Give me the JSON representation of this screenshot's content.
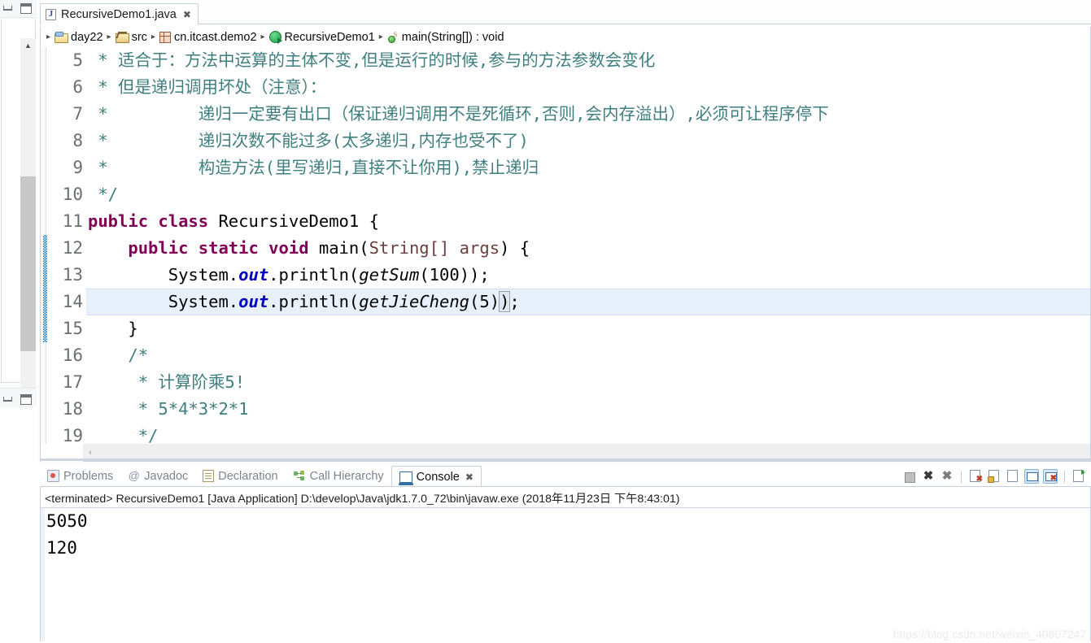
{
  "window": {
    "left_bar": {
      "minimize_icon": "minimize-icon",
      "maximize_icon": "maximize-icon",
      "scroll_up": "▲",
      "scroll_down": "▼"
    }
  },
  "editor": {
    "tab": {
      "label": "RecursiveDemo1.java",
      "close_glyph": "✖",
      "icon": "java-file-icon"
    },
    "breadcrumb": {
      "arrow": "▸",
      "items": [
        {
          "label": "day22",
          "icon": "project-folder-icon"
        },
        {
          "label": "src",
          "icon": "source-folder-icon"
        },
        {
          "label": "cn.itcast.demo2",
          "icon": "package-icon"
        },
        {
          "label": "RecursiveDemo1",
          "icon": "class-icon"
        },
        {
          "label": "main(String[]) : void",
          "icon": "method-static-icon"
        }
      ]
    },
    "first_visible_line": 5,
    "highlighted_line": 14,
    "changed_lines": {
      "from": 12,
      "to": 15
    },
    "lines": [
      {
        "num": "5",
        "segments": [
          {
            "t": " * ",
            "c": "cmt"
          },
          {
            "t": "适合于：方法中运算的主体不变,但是运行的时候,参与的方法参数会变化",
            "c": "cmt"
          }
        ]
      },
      {
        "num": "6",
        "segments": [
          {
            "t": " * ",
            "c": "cmt"
          },
          {
            "t": "但是递归调用坏处（注意）：",
            "c": "cmt"
          }
        ]
      },
      {
        "num": "7",
        "segments": [
          {
            "t": " * ",
            "c": "cmt"
          },
          {
            "t": "        递归一定要有出口（保证递归调用不是死循环,否则,会内存溢出）,必须可让程序停下",
            "c": "cmt"
          }
        ]
      },
      {
        "num": "8",
        "segments": [
          {
            "t": " * ",
            "c": "cmt"
          },
          {
            "t": "        递归次数不能过多(太多递归,内存也受不了)",
            "c": "cmt"
          }
        ]
      },
      {
        "num": "9",
        "segments": [
          {
            "t": " * ",
            "c": "cmt"
          },
          {
            "t": "        构造方法(里写递归,直接不让你用),禁止递归",
            "c": "cmt"
          }
        ]
      },
      {
        "num": "10",
        "segments": [
          {
            "t": " */",
            "c": "cmt"
          }
        ]
      },
      {
        "num": "11",
        "segments": [
          {
            "t": "public class ",
            "c": "kw"
          },
          {
            "t": "RecursiveDemo1 {",
            "c": "plain"
          }
        ]
      },
      {
        "num": "12",
        "segments": [
          {
            "t": "    ",
            "c": "plain"
          },
          {
            "t": "public static void ",
            "c": "kw"
          },
          {
            "t": "main(",
            "c": "plain"
          },
          {
            "t": "String[] args",
            "c": "param"
          },
          {
            "t": ") {",
            "c": "plain"
          }
        ]
      },
      {
        "num": "13",
        "segments": [
          {
            "t": "        System.",
            "c": "plain"
          },
          {
            "t": "out",
            "c": "stat"
          },
          {
            "t": ".println(",
            "c": "plain"
          },
          {
            "t": "getSum",
            "c": "mth"
          },
          {
            "t": "(100));",
            "c": "plain"
          }
        ]
      },
      {
        "num": "14",
        "segments": [
          {
            "t": "        System.",
            "c": "plain"
          },
          {
            "t": "out",
            "c": "stat"
          },
          {
            "t": ".println(",
            "c": "plain"
          },
          {
            "t": "getJieCheng",
            "c": "mth"
          },
          {
            "t": "(5)",
            "c": "plain"
          },
          {
            "t": ")",
            "c": "bracket"
          },
          {
            "t": ";",
            "c": "plain"
          }
        ]
      },
      {
        "num": "15",
        "segments": [
          {
            "t": "    }",
            "c": "plain"
          }
        ]
      },
      {
        "num": "16",
        "segments": [
          {
            "t": "    /*",
            "c": "cmt"
          }
        ]
      },
      {
        "num": "17",
        "segments": [
          {
            "t": "     * 计算阶乘5!",
            "c": "cmt"
          }
        ]
      },
      {
        "num": "18",
        "segments": [
          {
            "t": "     * 5*4*3*2*1",
            "c": "cmt"
          }
        ]
      },
      {
        "num": "19",
        "segments": [
          {
            "t": "     */",
            "c": "cmt"
          }
        ]
      }
    ],
    "hscroll_left_glyph": "‹"
  },
  "bottom_panel": {
    "tabs": [
      {
        "label": "Problems",
        "icon": "problems-icon",
        "active": false,
        "closable": false
      },
      {
        "label": "Javadoc",
        "icon": "javadoc-icon",
        "active": false,
        "closable": false
      },
      {
        "label": "Declaration",
        "icon": "declaration-icon",
        "active": false,
        "closable": false
      },
      {
        "label": "Call Hierarchy",
        "icon": "call-hierarchy-icon",
        "active": false,
        "closable": false
      },
      {
        "label": "Console",
        "icon": "console-icon",
        "active": true,
        "closable": true
      }
    ],
    "tab_close_glyph": "✖",
    "toolbar": [
      {
        "name": "terminate-button",
        "glyph": ""
      },
      {
        "name": "remove-launch-button",
        "glyph": "✖"
      },
      {
        "name": "remove-all-terminated-button",
        "glyph": "✖"
      },
      {
        "name": "clear-console-button",
        "glyph": ""
      },
      {
        "name": "scroll-lock-button",
        "glyph": ""
      },
      {
        "name": "word-wrap-button",
        "glyph": ""
      },
      {
        "name": "show-console-on-output-button",
        "glyph": ""
      },
      {
        "name": "pin-console-button",
        "glyph": ""
      },
      {
        "name": "display-selected-console-button",
        "glyph": ""
      }
    ],
    "console": {
      "status_line": "<terminated> RecursiveDemo1 [Java Application] D:\\develop\\Java\\jdk1.7.0_72\\bin\\javaw.exe (2018年11月23日 下午8:43:01)",
      "output": [
        "5050",
        "120"
      ]
    }
  },
  "watermark": "https://blog.csdn.net/weixin_40807247",
  "colors": {
    "comment": "#3f7f7f",
    "keyword": "#7f0055",
    "static_field": "#0000c0",
    "parameter": "#6a3e3e",
    "line_highlight": "#e8f1fb",
    "change_marker": "#0a74c8"
  }
}
